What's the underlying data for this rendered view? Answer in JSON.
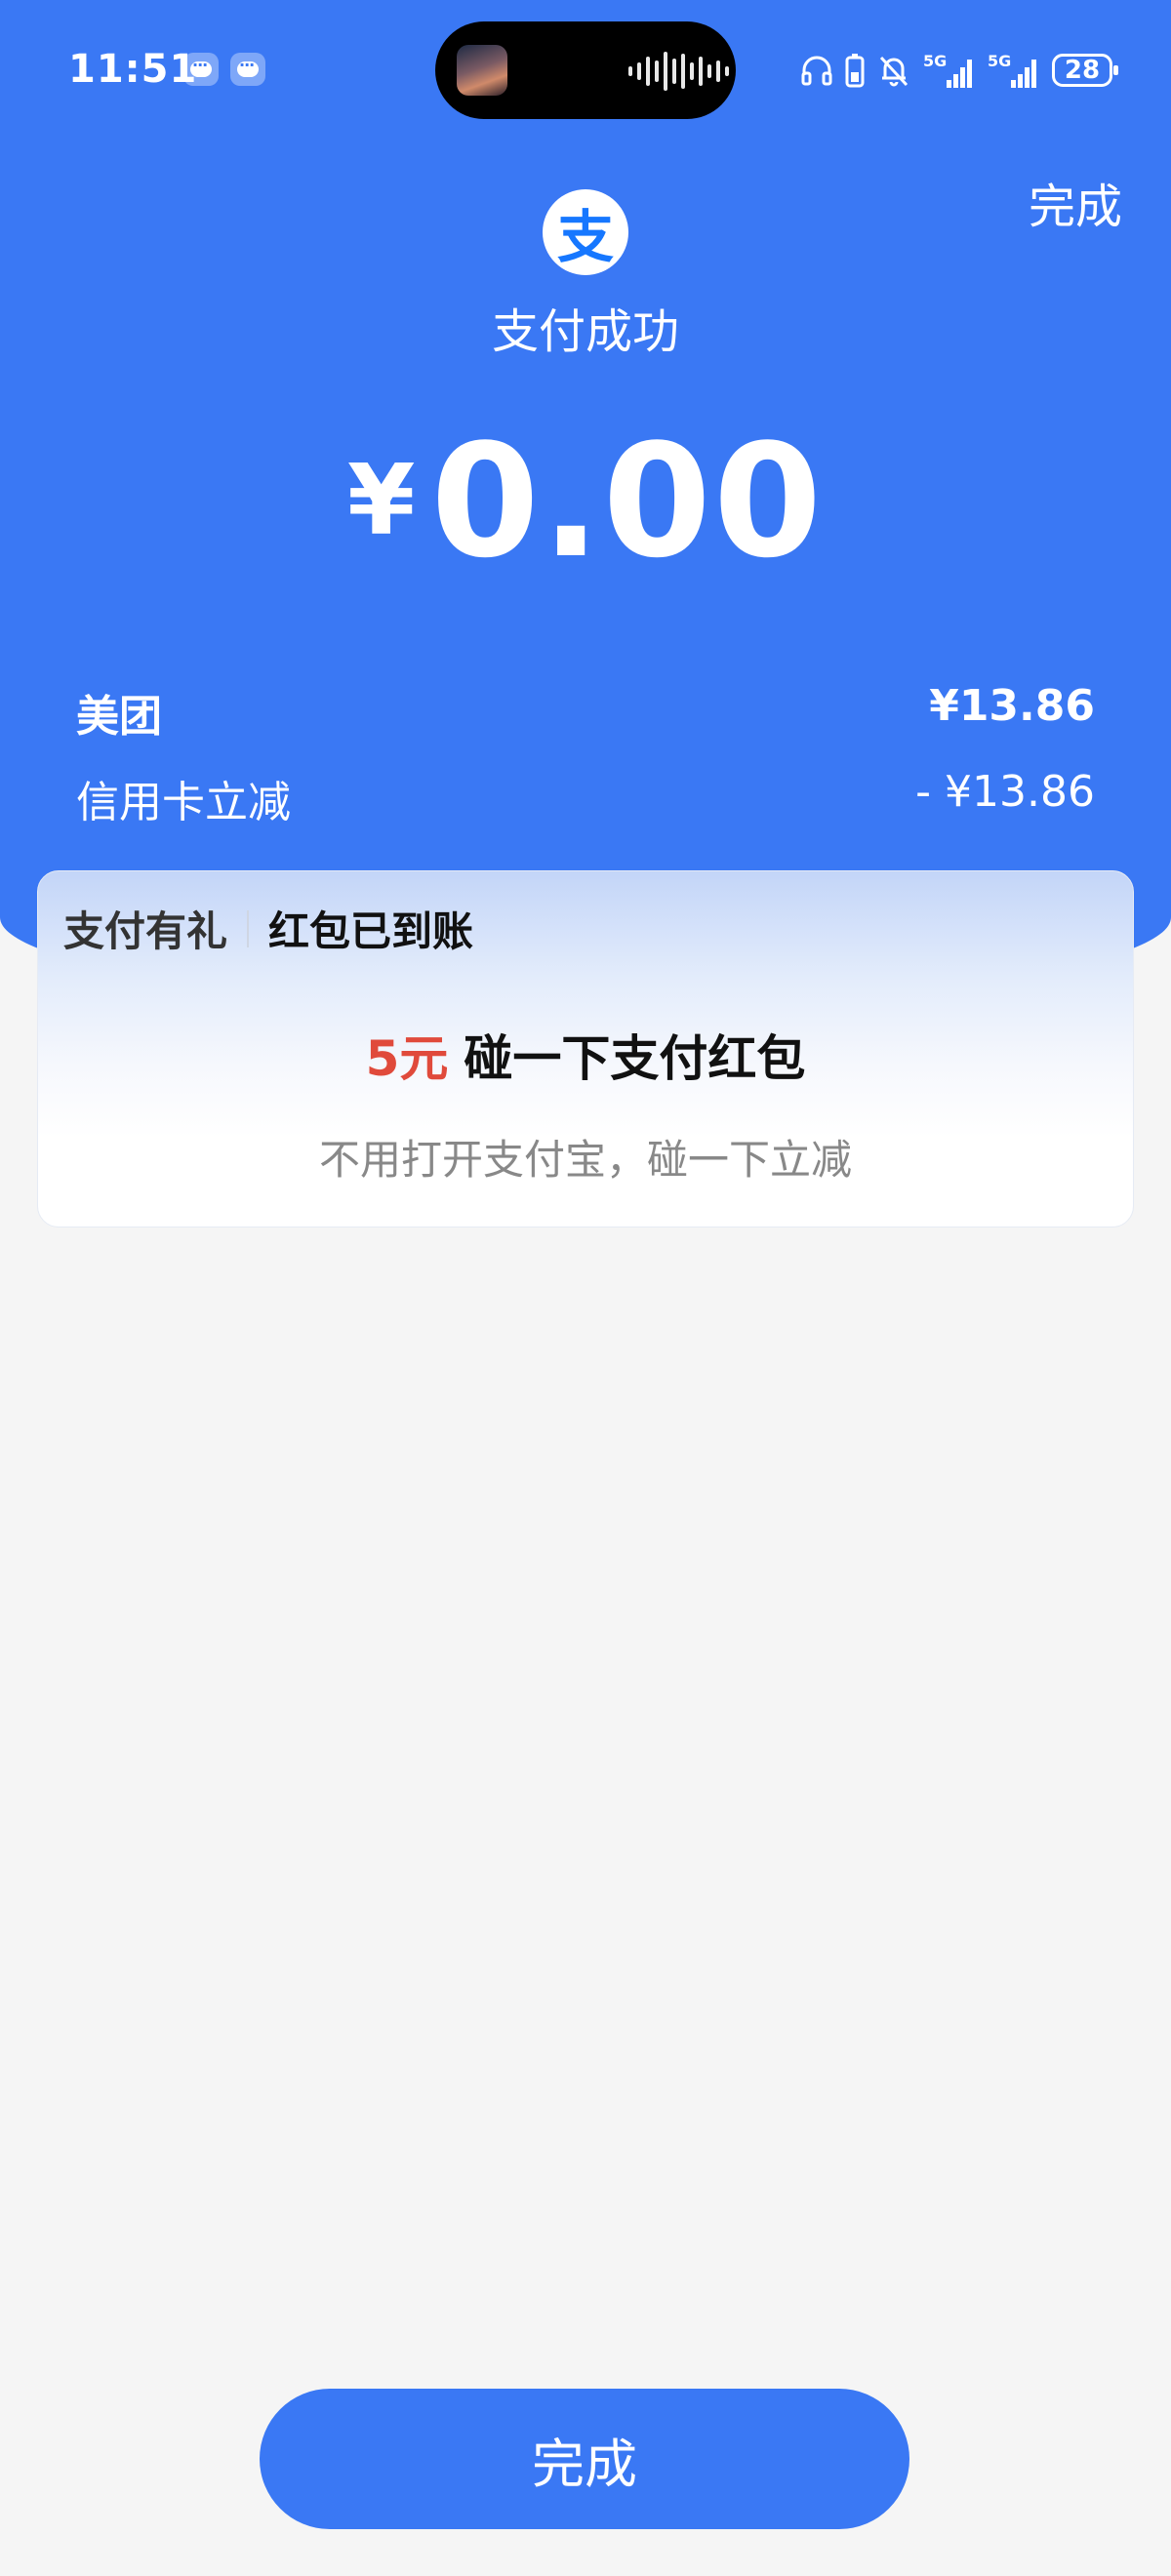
{
  "status_bar": {
    "time": "11:51",
    "battery": "28",
    "network_1": "5G",
    "network_2": "5G"
  },
  "header": {
    "done_label": "完成",
    "logo_glyph": "支",
    "status_text": "支付成功"
  },
  "amount": {
    "currency": "¥",
    "value": "0.00"
  },
  "details": [
    {
      "label": "美团",
      "value": "¥13.86"
    },
    {
      "label": "信用卡立减",
      "value": "- ¥13.86"
    }
  ],
  "promo": {
    "brand": "支付有礼",
    "title": "红包已到账",
    "amount": "5元",
    "headline": "碰一下支付红包",
    "subtitle": "不用打开支付宝，碰一下立减"
  },
  "footer": {
    "done_button_label": "完成"
  },
  "colors": {
    "primary_blue": "#3a78f4",
    "promo_red": "#e04a3b",
    "background": "#f5f5f5"
  }
}
